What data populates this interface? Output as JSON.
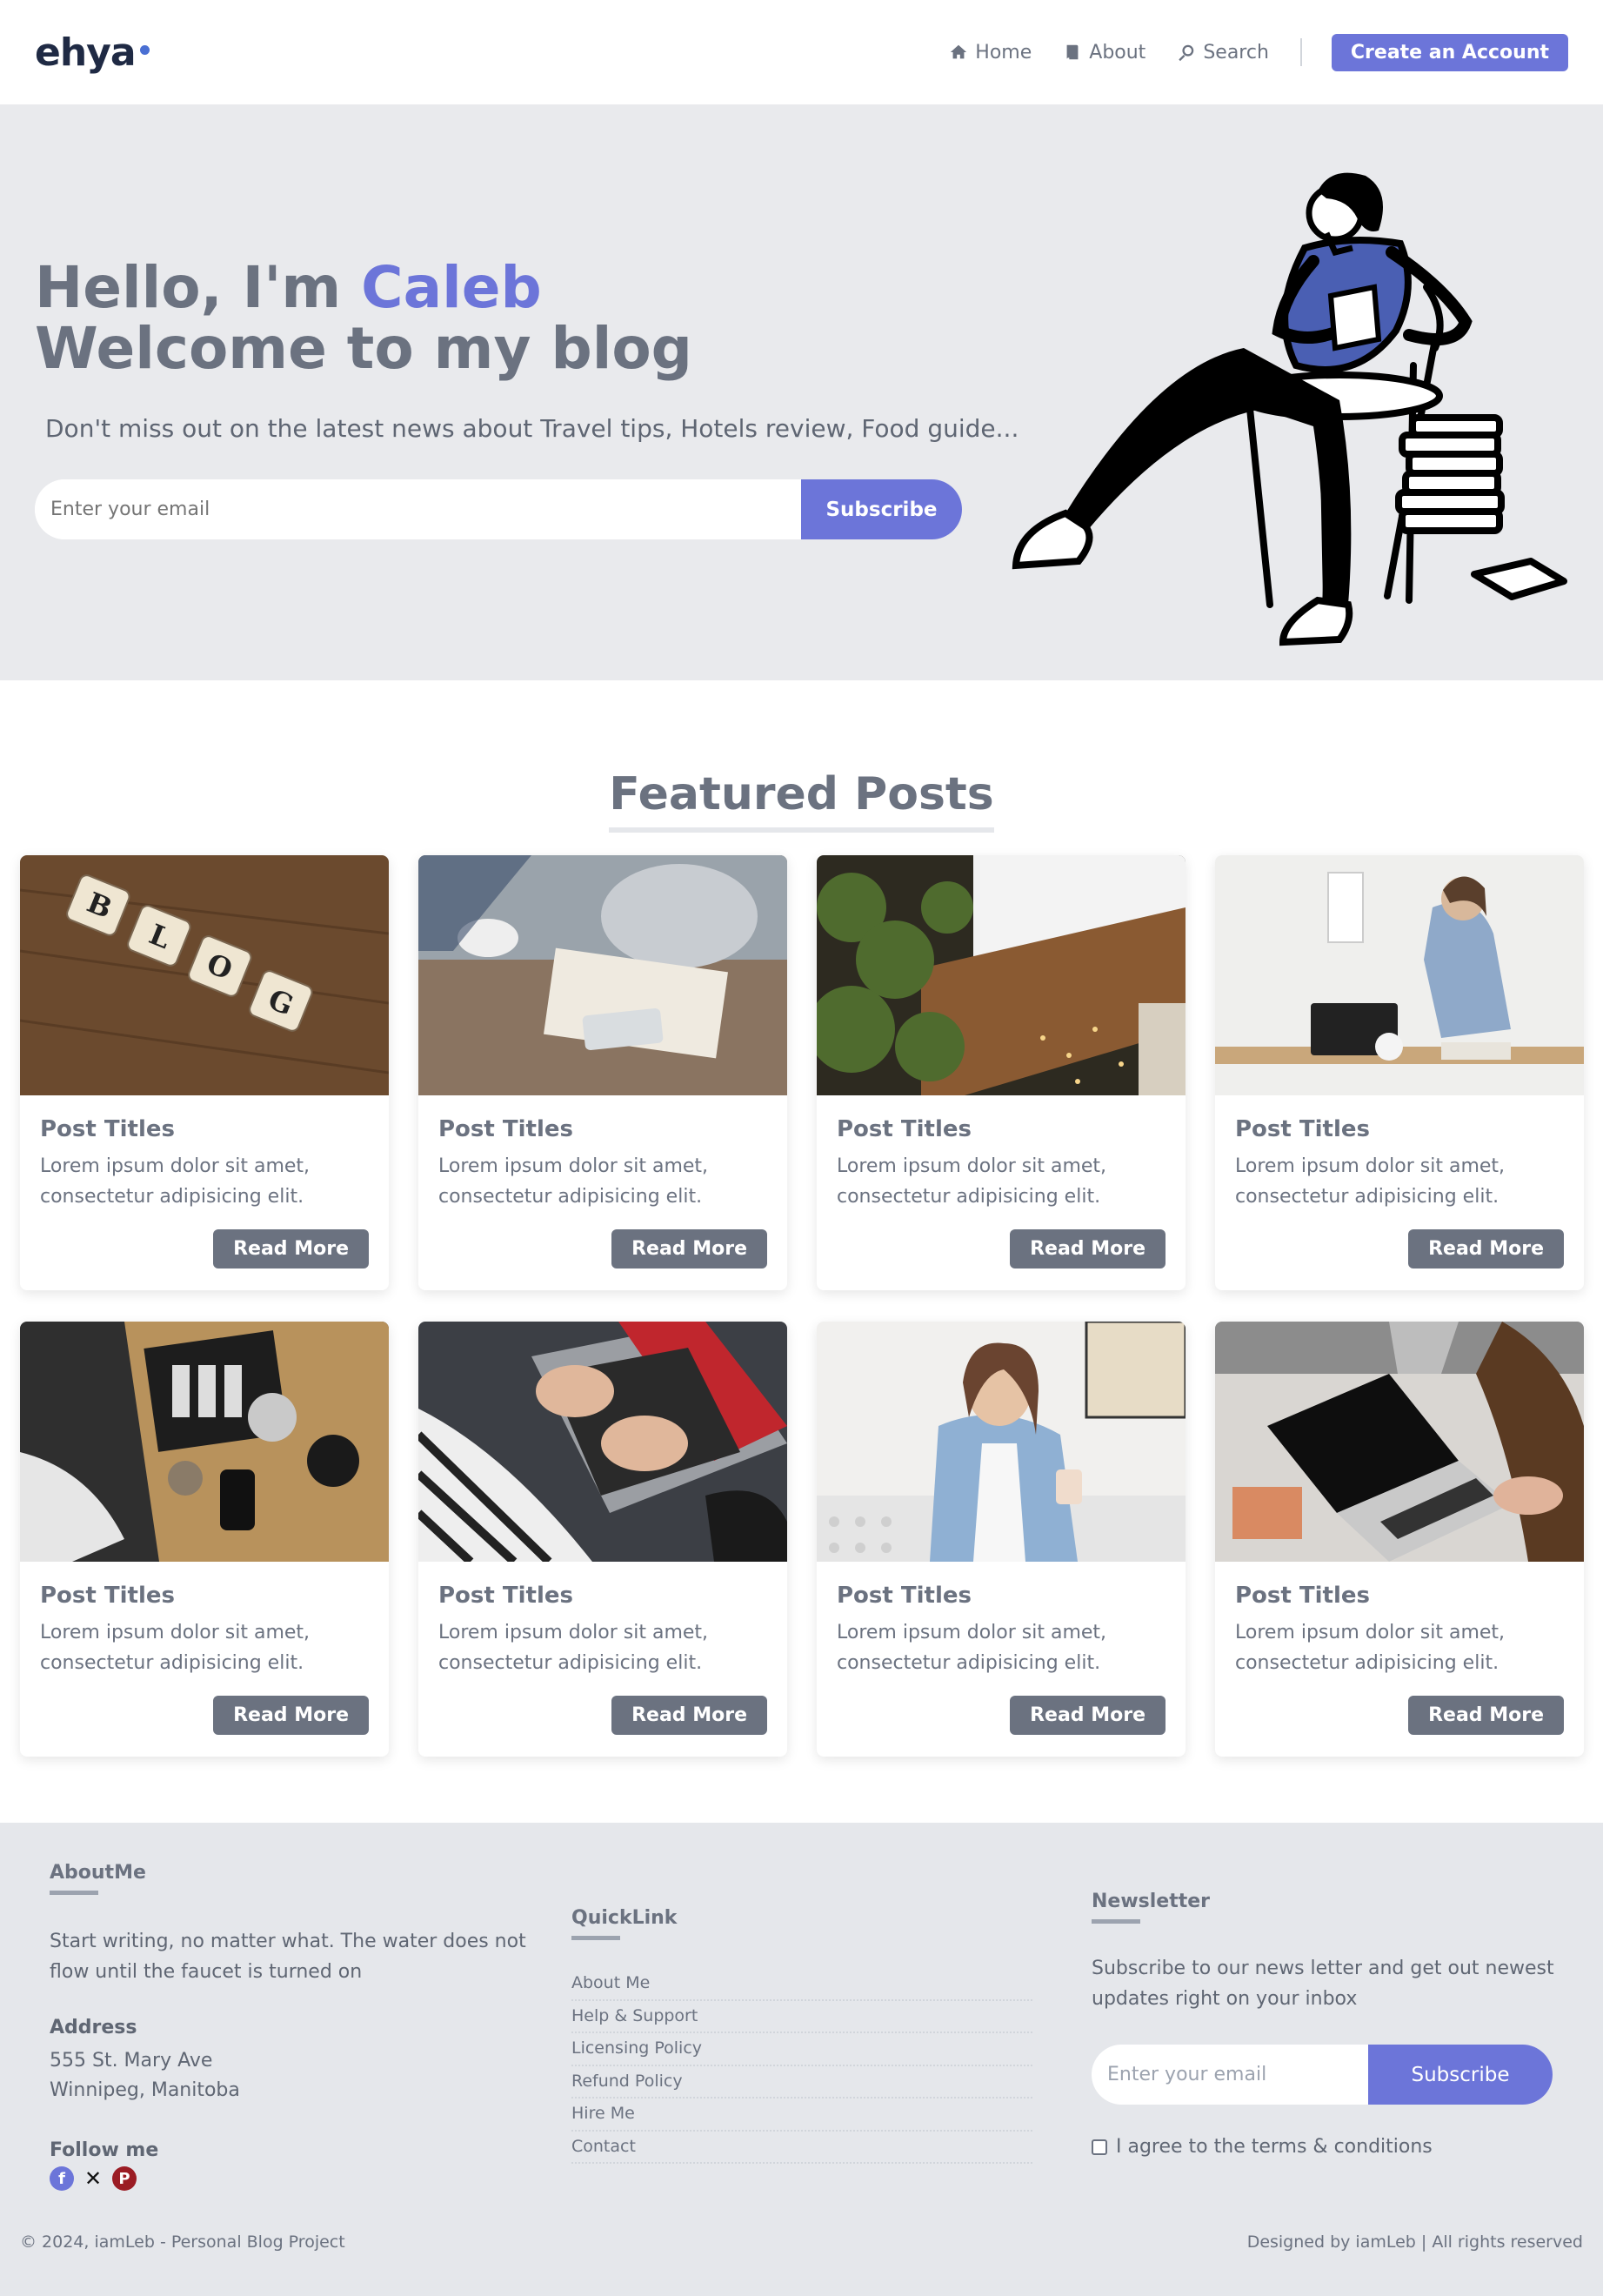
{
  "nav": {
    "logo": "ehya",
    "links": [
      {
        "label": "Home",
        "icon": "home-icon"
      },
      {
        "label": "About",
        "icon": "book-icon"
      },
      {
        "label": "Search",
        "icon": "search-icon"
      }
    ],
    "cta": "Create an Account"
  },
  "hero": {
    "greeting": "Hello, I'm ",
    "name": "Caleb",
    "line2": "Welcome to my blog",
    "subtitle": "Don't miss out on the latest news about Travel tips, Hotels review, Food guide...",
    "email_placeholder": "Enter your email",
    "subscribe": "Subscribe"
  },
  "featured": {
    "title": "Featured Posts",
    "posts": [
      {
        "title": "Post Titles",
        "text": "Lorem ipsum dolor sit amet, consectetur adipisicing elit.",
        "button": "Read More"
      },
      {
        "title": "Post Titles",
        "text": "Lorem ipsum dolor sit amet, consectetur adipisicing elit.",
        "button": "Read More"
      },
      {
        "title": "Post Titles",
        "text": "Lorem ipsum dolor sit amet, consectetur adipisicing elit.",
        "button": "Read More"
      },
      {
        "title": "Post Titles",
        "text": "Lorem ipsum dolor sit amet, consectetur adipisicing elit.",
        "button": "Read More"
      },
      {
        "title": "Post Titles",
        "text": "Lorem ipsum dolor sit amet, consectetur adipisicing elit.",
        "button": "Read More"
      },
      {
        "title": "Post Titles",
        "text": "Lorem ipsum dolor sit amet, consectetur adipisicing elit.",
        "button": "Read More"
      },
      {
        "title": "Post Titles",
        "text": "Lorem ipsum dolor sit amet, consectetur adipisicing elit.",
        "button": "Read More"
      },
      {
        "title": "Post Titles",
        "text": "Lorem ipsum dolor sit amet, consectetur adipisicing elit.",
        "button": "Read More"
      }
    ]
  },
  "footer": {
    "about_heading": "AboutMe",
    "about_text": "Start writing, no matter what. The water does not flow until the faucet is turned on",
    "address_label": "Address",
    "address_line1": "555 St. Mary Ave",
    "address_line2": "Winnipeg, Manitoba",
    "follow_label": "Follow me",
    "quicklink_heading": "QuickLink",
    "quicklinks": [
      "About Me",
      "Help & Support",
      "Licensing Policy",
      "Refund Policy",
      "Hire Me",
      "Contact"
    ],
    "newsletter_heading": "Newsletter",
    "newsletter_text": "Subscribe to our news letter and get out newest updates right on your inbox",
    "newsletter_placeholder": "Enter your email",
    "newsletter_button": "Subscribe",
    "agree_text": "I agree to the terms & conditions",
    "copyright": "© 2024, iamLeb - Personal Blog Project",
    "credits": "Designed by iamLeb | All rights reserved"
  },
  "colors": {
    "accent": "#6c75d9",
    "text": "#6b7280",
    "hero_bg": "#e9eaed",
    "footer_bg": "#e5e7eb"
  }
}
